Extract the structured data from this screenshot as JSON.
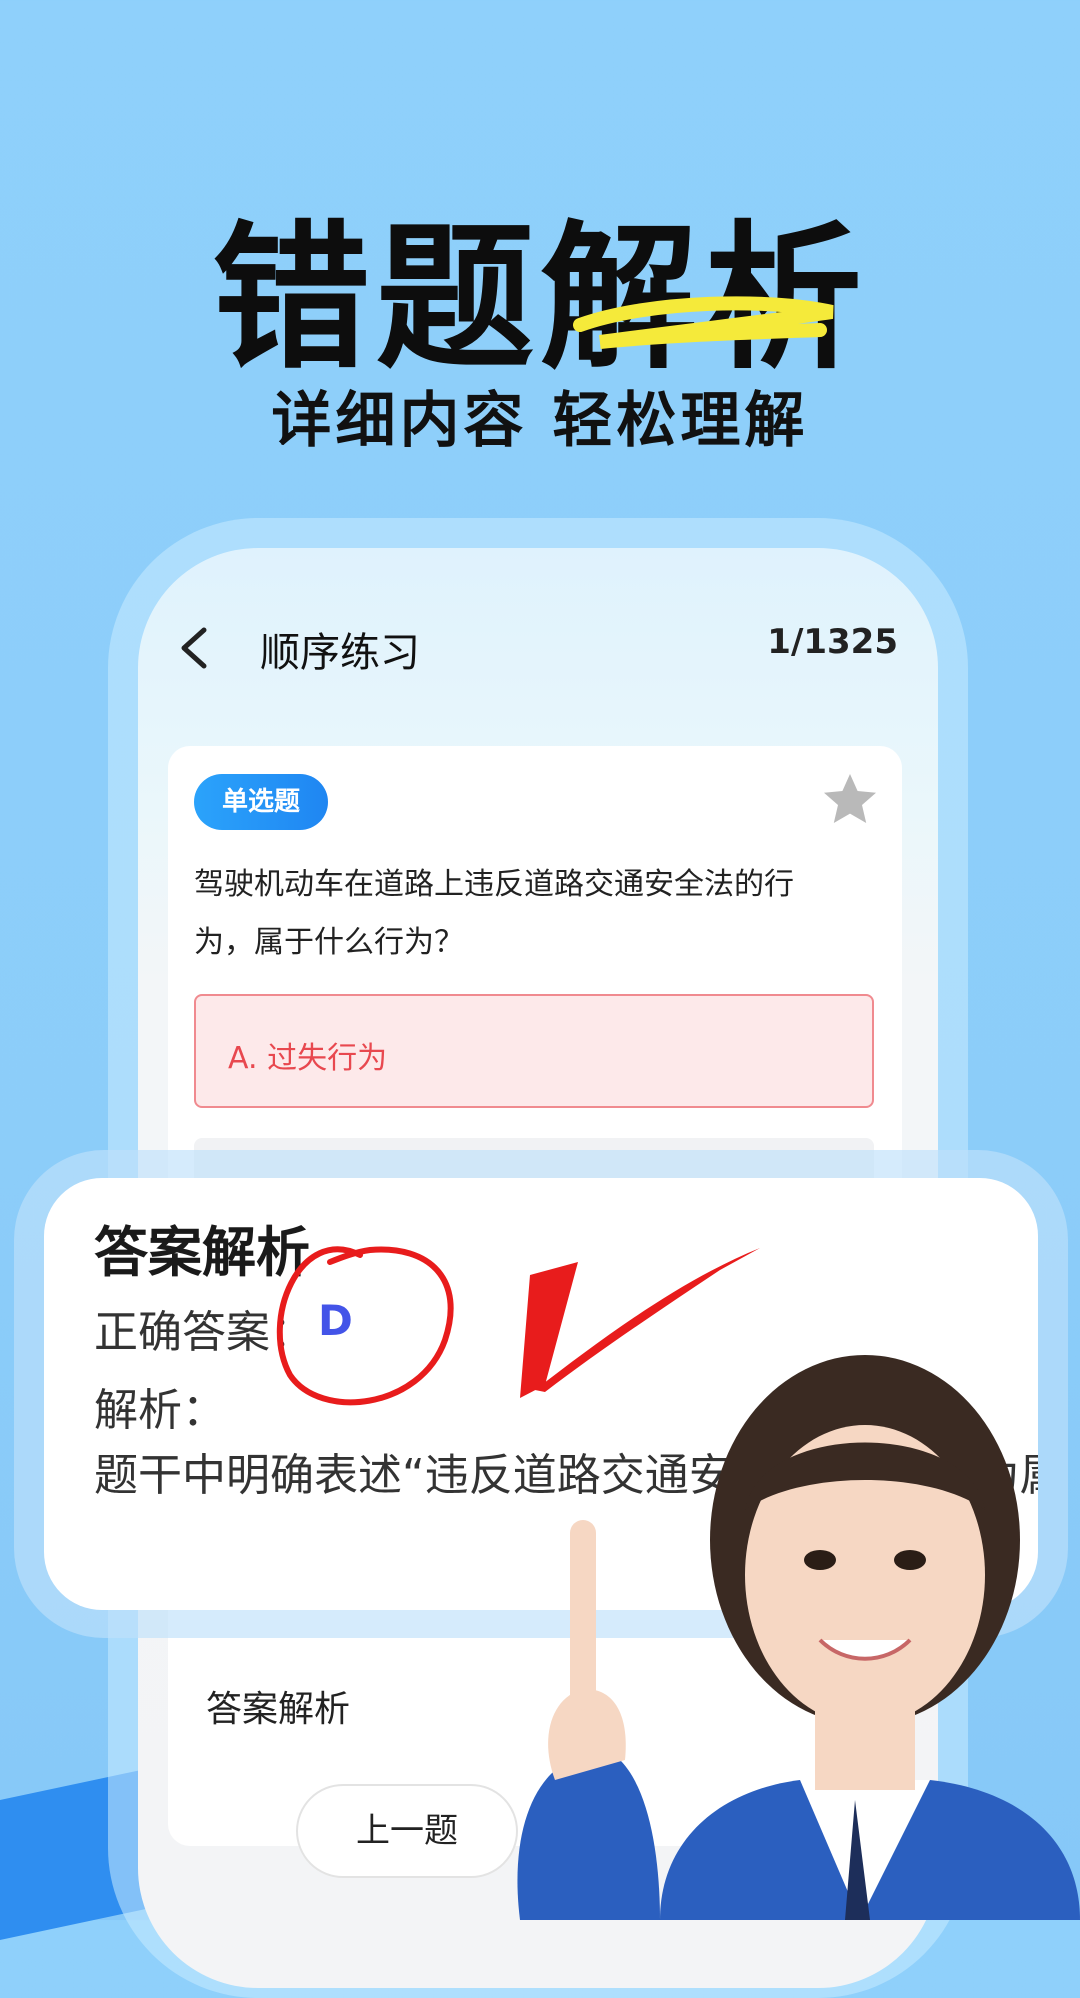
{
  "hero": {
    "title": "错题解析",
    "subtitle": "详细内容 轻松理解"
  },
  "nav": {
    "back_icon": "chevron-left-icon",
    "title": "顺序练习",
    "progress": "1/1325"
  },
  "question": {
    "type_badge": "单选题",
    "favorite_icon": "star-icon",
    "text": "驾驶机动车在道路上违反道路交通安全法的行为，属于什么行为？",
    "options": [
      {
        "label": "A. 过失行为",
        "state": "wrong"
      }
    ]
  },
  "analysis_popup": {
    "title": "答案解析",
    "answer_label": "正确答案：",
    "answer_value": "D",
    "analysis_label": "解析：",
    "analysis_text": "题干中明确表述“违反道路交通安全法”，该行为属于违法行为。"
  },
  "analysis_section_title": "答案解析",
  "prev_button": "上一题",
  "colors": {
    "background": "#8fd0fb",
    "badge": "#1f86f2",
    "wrong_option_text": "#e8484f",
    "wrong_option_bg": "#fde9ea",
    "answer_value": "#4354e8",
    "mark_red": "#e81c1c"
  }
}
